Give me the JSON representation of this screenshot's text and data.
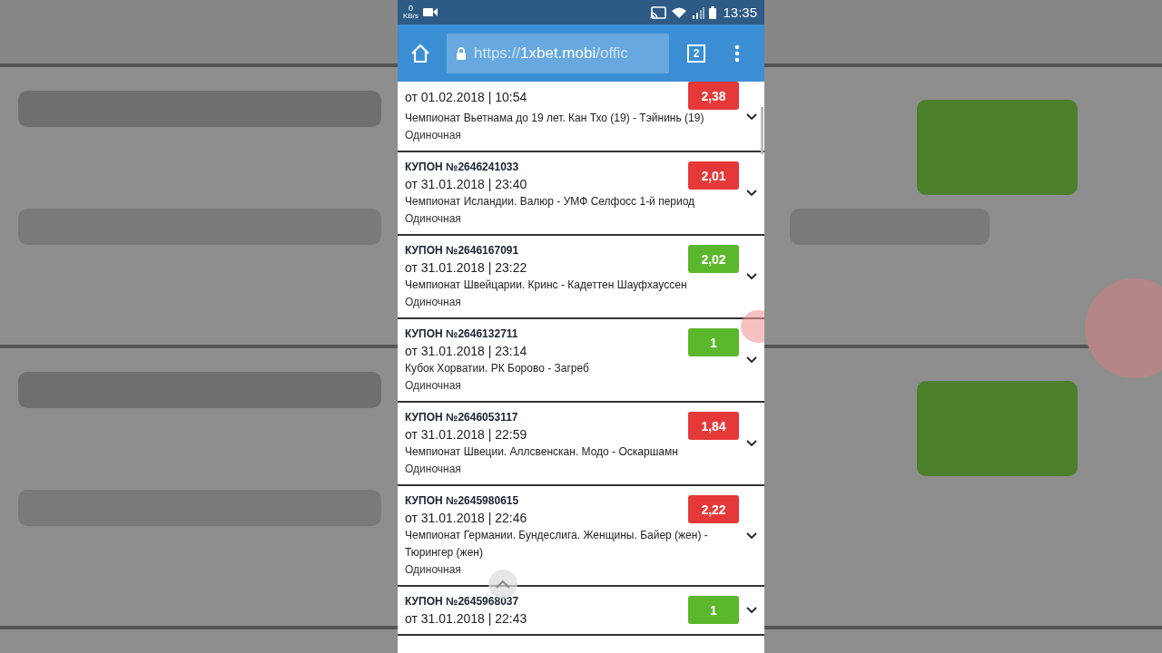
{
  "status_bar": {
    "network_speed": "0",
    "network_unit": "KB/s",
    "time": "13:35"
  },
  "browser": {
    "url_scheme": "https://",
    "url_host": "1xbet.mobi",
    "url_path": "/offic",
    "tab_count": "2"
  },
  "coupons": [
    {
      "date": "от 01.02.2018 | 10:54",
      "event": "Чемпионат Вьетнама до 19 лет. Кан Тхо (19) - Тэйнинь (19)",
      "type": "Одиночная",
      "odds": "2,38",
      "color": "#e53838"
    },
    {
      "title": "КУПОН №2646241033",
      "date": "от 31.01.2018 | 23:40",
      "event": "Чемпионат Исландии. Валюр - УМФ Селфосс 1-й период",
      "type": "Одиночная",
      "odds": "2,01",
      "color": "#e53838"
    },
    {
      "title": "КУПОН №2646167091",
      "date": "от 31.01.2018 | 23:22",
      "event": "Чемпионат Швейцарии. Кринс - Кадеттен Шауфхауссен",
      "type": "Одиночная",
      "odds": "2,02",
      "color": "#5bb72b"
    },
    {
      "title": "КУПОН №2646132711",
      "date": "от 31.01.2018 | 23:14",
      "event": "Кубок Хорватии. РК Борово - Загреб",
      "type": "Одиночная",
      "odds": "1",
      "color": "#5bb72b"
    },
    {
      "title": "КУПОН №2646053117",
      "date": "от 31.01.2018 | 22:59",
      "event": "Чемпионат Швеции. Аллсвенскан. Модо - Оскаршамн",
      "type": "Одиночная",
      "odds": "1,84",
      "color": "#e53838"
    },
    {
      "title": "КУПОН №2645980615",
      "date": "от 31.01.2018 | 22:46",
      "event": "Чемпионат Германии. Бундеслига. Женщины. Байер (жен) - Тюрингер (жен)",
      "type": "Одиночная",
      "odds": "2,22",
      "color": "#e53838"
    },
    {
      "title": "КУПОН №2645968037",
      "date": "от 31.01.2018 | 22:43",
      "odds": "1",
      "color": "#5bb72b"
    }
  ]
}
